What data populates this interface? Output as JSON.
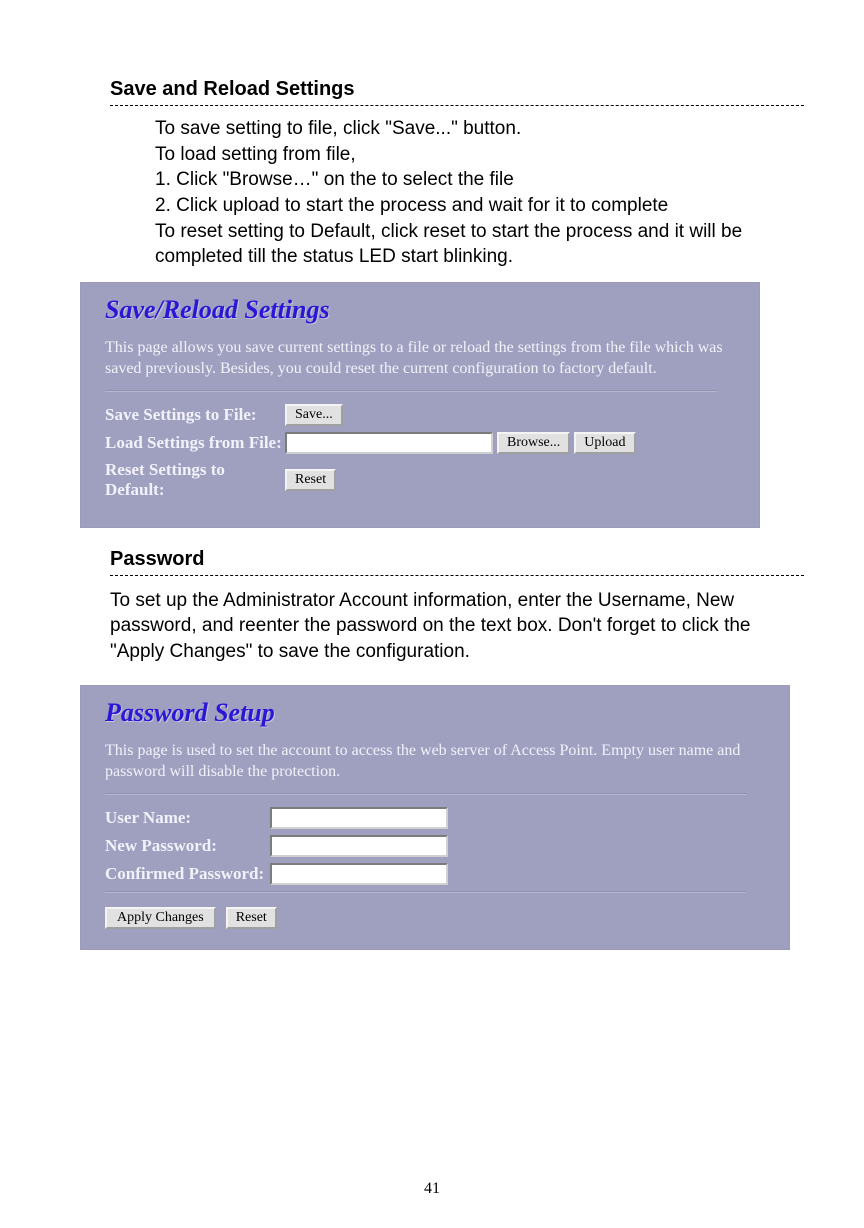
{
  "section1": {
    "title": "Save and Reload Settings",
    "lines": {
      "l1": "To save setting to file, click \"Save...\" button.",
      "l2": "To load setting from file,",
      "l3": "1. Click \"Browse…\" on the to select the file",
      "l4": "2. Click upload to start the process and wait for it to complete",
      "l5": "To reset setting to Default, click reset to start the process and it will be completed till the status LED start blinking."
    }
  },
  "panel1": {
    "title": "Save/Reload Settings",
    "desc": "This page allows you save current settings to a file or reload the settings from the file which was saved previously. Besides, you could reset the current configuration to factory default.",
    "rows": {
      "save_label": "Save Settings to File:",
      "save_btn": "Save...",
      "load_label": "Load Settings from File:",
      "browse_btn": "Browse...",
      "upload_btn": "Upload",
      "reset_label": "Reset Settings to Default:",
      "reset_btn": "Reset"
    }
  },
  "section2": {
    "title": "Password",
    "body": "To set up the Administrator Account information, enter the Username, New password, and reenter the password on the text box. Don't forget to click the \"Apply Changes\" to save the configuration."
  },
  "panel2": {
    "title": "Password Setup",
    "desc": "This page is used to set the account to access the web server of Access Point. Empty user name and password will disable the protection.",
    "rows": {
      "user_label": "User Name:",
      "newpw_label": "New Password:",
      "confpw_label": "Confirmed Password:",
      "apply_btn": "Apply Changes",
      "reset_btn": "Reset"
    }
  },
  "page_number": "41"
}
